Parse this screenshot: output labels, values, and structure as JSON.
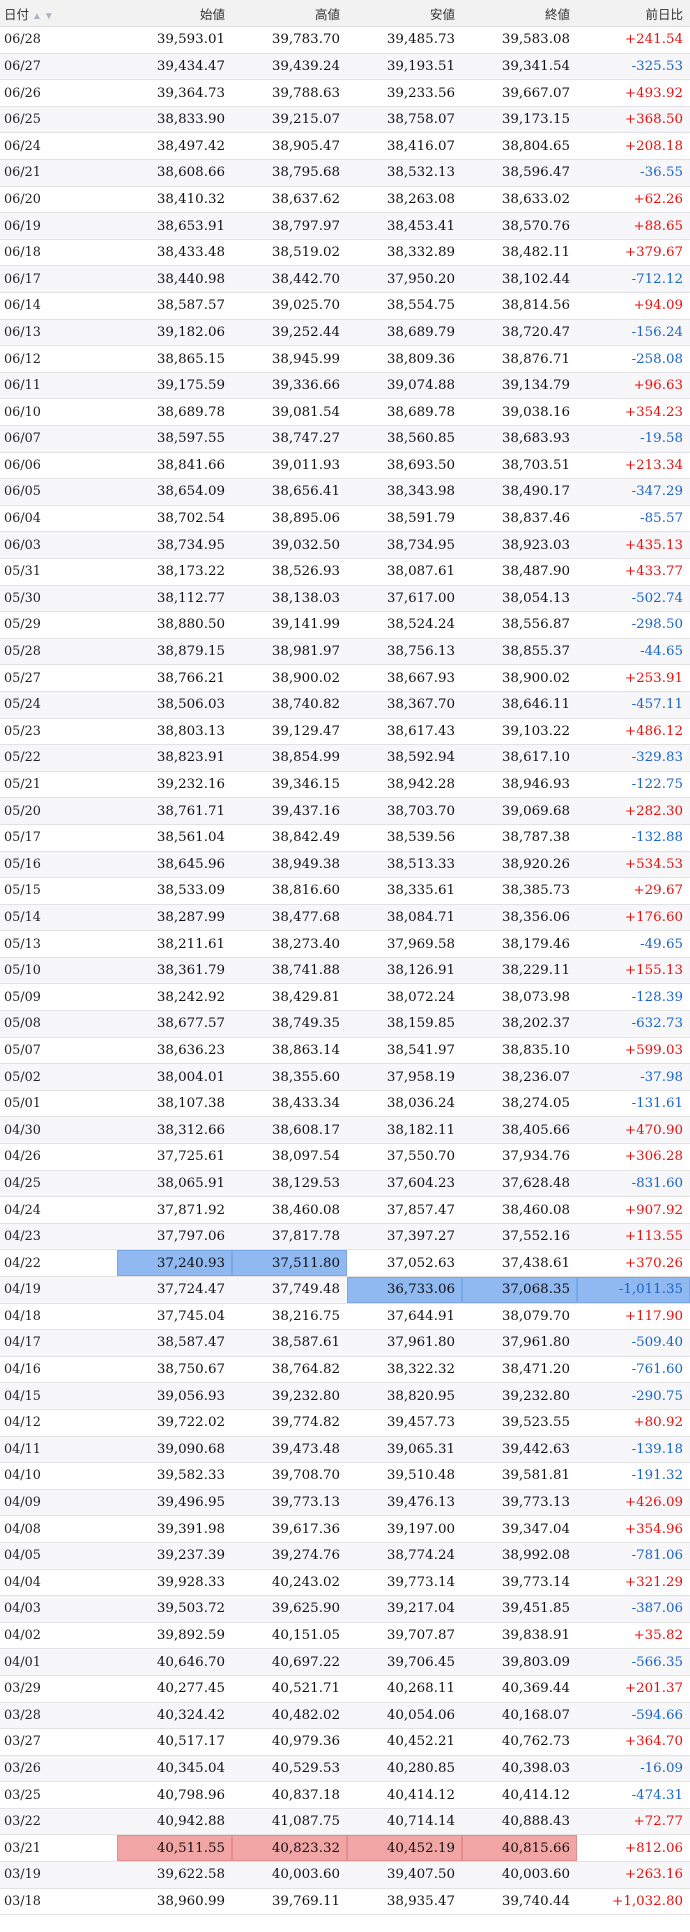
{
  "table": {
    "headers": {
      "date": "日付",
      "open": "始値",
      "high": "高値",
      "low": "安値",
      "close": "終値",
      "change": "前日比"
    },
    "rows": [
      [
        "06/28",
        "39,593.01",
        "39,783.70",
        "39,485.73",
        "39,583.08",
        "+241.54"
      ],
      [
        "06/27",
        "39,434.47",
        "39,439.24",
        "39,193.51",
        "39,341.54",
        "-325.53"
      ],
      [
        "06/26",
        "39,364.73",
        "39,788.63",
        "39,233.56",
        "39,667.07",
        "+493.92"
      ],
      [
        "06/25",
        "38,833.90",
        "39,215.07",
        "38,758.07",
        "39,173.15",
        "+368.50"
      ],
      [
        "06/24",
        "38,497.42",
        "38,905.47",
        "38,416.07",
        "38,804.65",
        "+208.18"
      ],
      [
        "06/21",
        "38,608.66",
        "38,795.68",
        "38,532.13",
        "38,596.47",
        "-36.55"
      ],
      [
        "06/20",
        "38,410.32",
        "38,637.62",
        "38,263.08",
        "38,633.02",
        "+62.26"
      ],
      [
        "06/19",
        "38,653.91",
        "38,797.97",
        "38,453.41",
        "38,570.76",
        "+88.65"
      ],
      [
        "06/18",
        "38,433.48",
        "38,519.02",
        "38,332.89",
        "38,482.11",
        "+379.67"
      ],
      [
        "06/17",
        "38,440.98",
        "38,442.70",
        "37,950.20",
        "38,102.44",
        "-712.12"
      ],
      [
        "06/14",
        "38,587.57",
        "39,025.70",
        "38,554.75",
        "38,814.56",
        "+94.09"
      ],
      [
        "06/13",
        "39,182.06",
        "39,252.44",
        "38,689.79",
        "38,720.47",
        "-156.24"
      ],
      [
        "06/12",
        "38,865.15",
        "38,945.99",
        "38,809.36",
        "38,876.71",
        "-258.08"
      ],
      [
        "06/11",
        "39,175.59",
        "39,336.66",
        "39,074.88",
        "39,134.79",
        "+96.63"
      ],
      [
        "06/10",
        "38,689.78",
        "39,081.54",
        "38,689.78",
        "39,038.16",
        "+354.23"
      ],
      [
        "06/07",
        "38,597.55",
        "38,747.27",
        "38,560.85",
        "38,683.93",
        "-19.58"
      ],
      [
        "06/06",
        "38,841.66",
        "39,011.93",
        "38,693.50",
        "38,703.51",
        "+213.34"
      ],
      [
        "06/05",
        "38,654.09",
        "38,656.41",
        "38,343.98",
        "38,490.17",
        "-347.29"
      ],
      [
        "06/04",
        "38,702.54",
        "38,895.06",
        "38,591.79",
        "38,837.46",
        "-85.57"
      ],
      [
        "06/03",
        "38,734.95",
        "39,032.50",
        "38,734.95",
        "38,923.03",
        "+435.13"
      ],
      [
        "05/31",
        "38,173.22",
        "38,526.93",
        "38,087.61",
        "38,487.90",
        "+433.77"
      ],
      [
        "05/30",
        "38,112.77",
        "38,138.03",
        "37,617.00",
        "38,054.13",
        "-502.74"
      ],
      [
        "05/29",
        "38,880.50",
        "39,141.99",
        "38,524.24",
        "38,556.87",
        "-298.50"
      ],
      [
        "05/28",
        "38,879.15",
        "38,981.97",
        "38,756.13",
        "38,855.37",
        "-44.65"
      ],
      [
        "05/27",
        "38,766.21",
        "38,900.02",
        "38,667.93",
        "38,900.02",
        "+253.91"
      ],
      [
        "05/24",
        "38,506.03",
        "38,740.82",
        "38,367.70",
        "38,646.11",
        "-457.11"
      ],
      [
        "05/23",
        "38,803.13",
        "39,129.47",
        "38,617.43",
        "39,103.22",
        "+486.12"
      ],
      [
        "05/22",
        "38,823.91",
        "38,854.99",
        "38,592.94",
        "38,617.10",
        "-329.83"
      ],
      [
        "05/21",
        "39,232.16",
        "39,346.15",
        "38,942.28",
        "38,946.93",
        "-122.75"
      ],
      [
        "05/20",
        "38,761.71",
        "39,437.16",
        "38,703.70",
        "39,069.68",
        "+282.30"
      ],
      [
        "05/17",
        "38,561.04",
        "38,842.49",
        "38,539.56",
        "38,787.38",
        "-132.88"
      ],
      [
        "05/16",
        "38,645.96",
        "38,949.38",
        "38,513.33",
        "38,920.26",
        "+534.53"
      ],
      [
        "05/15",
        "38,533.09",
        "38,816.60",
        "38,335.61",
        "38,385.73",
        "+29.67"
      ],
      [
        "05/14",
        "38,287.99",
        "38,477.68",
        "38,084.71",
        "38,356.06",
        "+176.60"
      ],
      [
        "05/13",
        "38,211.61",
        "38,273.40",
        "37,969.58",
        "38,179.46",
        "-49.65"
      ],
      [
        "05/10",
        "38,361.79",
        "38,741.88",
        "38,126.91",
        "38,229.11",
        "+155.13"
      ],
      [
        "05/09",
        "38,242.92",
        "38,429.81",
        "38,072.24",
        "38,073.98",
        "-128.39"
      ],
      [
        "05/08",
        "38,677.57",
        "38,749.35",
        "38,159.85",
        "38,202.37",
        "-632.73"
      ],
      [
        "05/07",
        "38,636.23",
        "38,863.14",
        "38,541.97",
        "38,835.10",
        "+599.03"
      ],
      [
        "05/02",
        "38,004.01",
        "38,355.60",
        "37,958.19",
        "38,236.07",
        "-37.98"
      ],
      [
        "05/01",
        "38,107.38",
        "38,433.34",
        "38,036.24",
        "38,274.05",
        "-131.61"
      ],
      [
        "04/30",
        "38,312.66",
        "38,608.17",
        "38,182.11",
        "38,405.66",
        "+470.90"
      ],
      [
        "04/26",
        "37,725.61",
        "38,097.54",
        "37,550.70",
        "37,934.76",
        "+306.28"
      ],
      [
        "04/25",
        "38,065.91",
        "38,129.53",
        "37,604.23",
        "37,628.48",
        "-831.60"
      ],
      [
        "04/24",
        "37,871.92",
        "38,460.08",
        "37,857.47",
        "38,460.08",
        "+907.92"
      ],
      [
        "04/23",
        "37,797.06",
        "37,817.78",
        "37,397.27",
        "37,552.16",
        "+113.55"
      ],
      [
        "04/22",
        "37,240.93",
        "37,511.80",
        "37,052.63",
        "37,438.61",
        "+370.26"
      ],
      [
        "04/19",
        "37,724.47",
        "37,749.48",
        "36,733.06",
        "37,068.35",
        "-1,011.35"
      ],
      [
        "04/18",
        "37,745.04",
        "38,216.75",
        "37,644.91",
        "38,079.70",
        "+117.90"
      ],
      [
        "04/17",
        "38,587.47",
        "38,587.61",
        "37,961.80",
        "37,961.80",
        "-509.40"
      ],
      [
        "04/16",
        "38,750.67",
        "38,764.82",
        "38,322.32",
        "38,471.20",
        "-761.60"
      ],
      [
        "04/15",
        "39,056.93",
        "39,232.80",
        "38,820.95",
        "39,232.80",
        "-290.75"
      ],
      [
        "04/12",
        "39,722.02",
        "39,774.82",
        "39,457.73",
        "39,523.55",
        "+80.92"
      ],
      [
        "04/11",
        "39,090.68",
        "39,473.48",
        "39,065.31",
        "39,442.63",
        "-139.18"
      ],
      [
        "04/10",
        "39,582.33",
        "39,708.70",
        "39,510.48",
        "39,581.81",
        "-191.32"
      ],
      [
        "04/09",
        "39,496.95",
        "39,773.13",
        "39,476.13",
        "39,773.13",
        "+426.09"
      ],
      [
        "04/08",
        "39,391.98",
        "39,617.36",
        "39,197.00",
        "39,347.04",
        "+354.96"
      ],
      [
        "04/05",
        "39,237.39",
        "39,274.76",
        "38,774.24",
        "38,992.08",
        "-781.06"
      ],
      [
        "04/04",
        "39,928.33",
        "40,243.02",
        "39,773.14",
        "39,773.14",
        "+321.29"
      ],
      [
        "04/03",
        "39,503.72",
        "39,625.90",
        "39,217.04",
        "39,451.85",
        "-387.06"
      ],
      [
        "04/02",
        "39,892.59",
        "40,151.05",
        "39,707.87",
        "39,838.91",
        "+35.82"
      ],
      [
        "04/01",
        "40,646.70",
        "40,697.22",
        "39,706.45",
        "39,803.09",
        "-566.35"
      ],
      [
        "03/29",
        "40,277.45",
        "40,521.71",
        "40,268.11",
        "40,369.44",
        "+201.37"
      ],
      [
        "03/28",
        "40,324.42",
        "40,482.02",
        "40,054.06",
        "40,168.07",
        "-594.66"
      ],
      [
        "03/27",
        "40,517.17",
        "40,979.36",
        "40,452.21",
        "40,762.73",
        "+364.70"
      ],
      [
        "03/26",
        "40,345.04",
        "40,529.53",
        "40,280.85",
        "40,398.03",
        "-16.09"
      ],
      [
        "03/25",
        "40,798.96",
        "40,837.18",
        "40,414.12",
        "40,414.12",
        "-474.31"
      ],
      [
        "03/22",
        "40,942.88",
        "41,087.75",
        "40,714.14",
        "40,888.43",
        "+72.77"
      ],
      [
        "03/21",
        "40,511.55",
        "40,823.32",
        "40,452.19",
        "40,815.66",
        "+812.06"
      ],
      [
        "03/19",
        "39,622.58",
        "40,003.60",
        "39,407.50",
        "40,003.60",
        "+263.16"
      ],
      [
        "03/18",
        "38,960.99",
        "39,769.11",
        "38,935.47",
        "39,740.44",
        "+1,032.80"
      ]
    ],
    "highlights": [
      {
        "row": 46,
        "col": 1,
        "tone": "blue"
      },
      {
        "row": 46,
        "col": 2,
        "tone": "blue"
      },
      {
        "row": 47,
        "col": 3,
        "tone": "blue"
      },
      {
        "row": 47,
        "col": 4,
        "tone": "blue"
      },
      {
        "row": 47,
        "col": 5,
        "tone": "blue"
      },
      {
        "row": 68,
        "col": 1,
        "tone": "red"
      },
      {
        "row": 68,
        "col": 2,
        "tone": "red"
      },
      {
        "row": 68,
        "col": 3,
        "tone": "red"
      },
      {
        "row": 68,
        "col": 4,
        "tone": "red"
      },
      {
        "row": 71,
        "col": 5,
        "tone": "red"
      }
    ]
  },
  "colors": {
    "up": "#e8100e",
    "down": "#1a64c8",
    "highlight_blue": "#8fb9f0",
    "highlight_red": "#f2a5a5"
  },
  "icons": {
    "sort": "sort-arrows-icon"
  }
}
